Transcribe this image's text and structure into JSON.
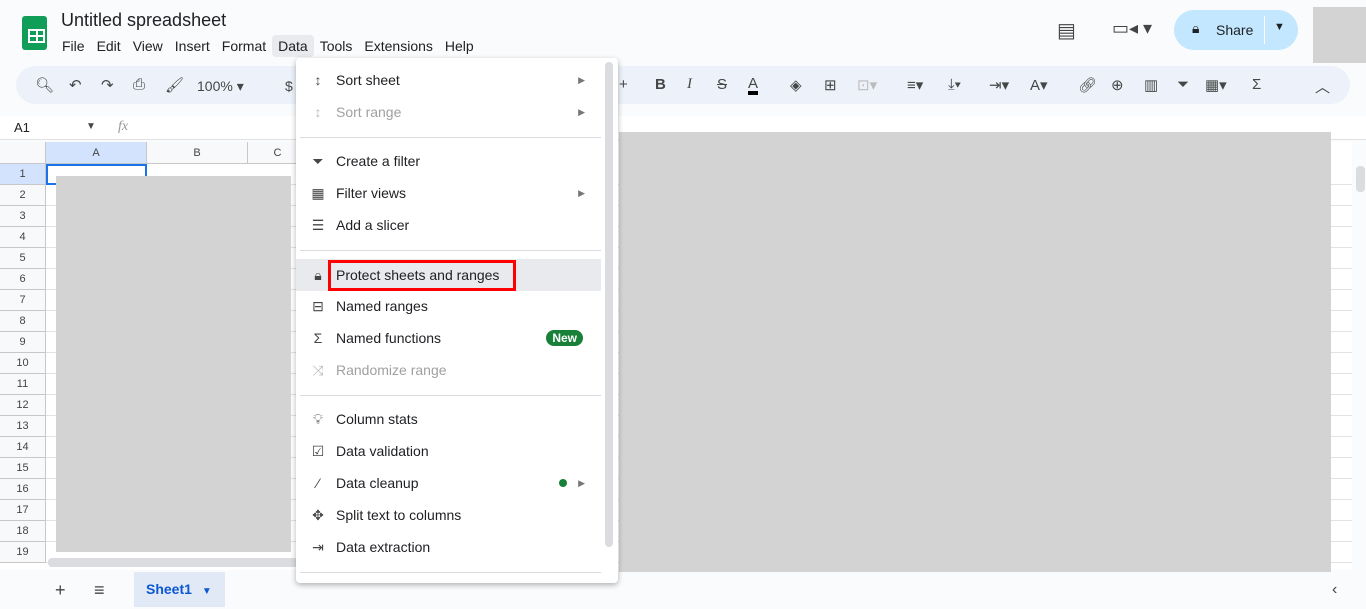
{
  "app": {
    "title": "Untitled spreadsheet"
  },
  "menubar": [
    "File",
    "Edit",
    "View",
    "Insert",
    "Format",
    "Data",
    "Tools",
    "Extensions",
    "Help"
  ],
  "toolbar": {
    "zoom": "100%",
    "currency": "$"
  },
  "formula_bar": {
    "cell_ref": "A1",
    "fx": "fx"
  },
  "header": {
    "share_label": "Share"
  },
  "columns": [
    "A",
    "B",
    "C"
  ],
  "rows": [
    "1",
    "2",
    "3",
    "4",
    "5",
    "6",
    "7",
    "8",
    "9",
    "10",
    "11",
    "12",
    "13",
    "14",
    "15",
    "16",
    "17",
    "18",
    "19"
  ],
  "data_menu": {
    "items": [
      {
        "icon": "sort-icon",
        "label": "Sort sheet",
        "submenu": true,
        "disabled": false
      },
      {
        "icon": "sort-icon",
        "label": "Sort range",
        "submenu": true,
        "disabled": true
      },
      {
        "icon": "filter-icon",
        "label": "Create a filter"
      },
      {
        "icon": "filter-views-icon",
        "label": "Filter views",
        "submenu": true
      },
      {
        "icon": "slicer-icon",
        "label": "Add a slicer"
      },
      {
        "icon": "lock-icon",
        "label": "Protect sheets and ranges",
        "highlighted": true
      },
      {
        "icon": "named-ranges-icon",
        "label": "Named ranges"
      },
      {
        "icon": "sigma-icon",
        "label": "Named functions",
        "badge": "New"
      },
      {
        "icon": "shuffle-icon",
        "label": "Randomize range",
        "disabled": true
      },
      {
        "icon": "lightbulb-icon",
        "label": "Column stats"
      },
      {
        "icon": "data-validation-icon",
        "label": "Data validation"
      },
      {
        "icon": "magic-wand-icon",
        "label": "Data cleanup",
        "submenu": true,
        "dot": true
      },
      {
        "icon": "split-icon",
        "label": "Split text to columns"
      },
      {
        "icon": "extraction-icon",
        "label": "Data extraction"
      }
    ]
  },
  "sheets": {
    "active": "Sheet1"
  },
  "colors": {
    "accent": "#0b57d0",
    "share_bg": "#c2e7ff",
    "badge": "#188038",
    "highlight_box": "#ff0000",
    "logo": "#0f9d58"
  }
}
